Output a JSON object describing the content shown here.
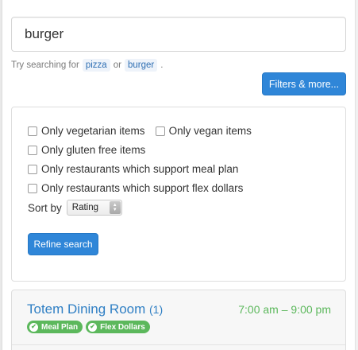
{
  "search": {
    "value": "burger"
  },
  "hint": {
    "prefix": "Try searching for",
    "example1": "pizza",
    "or": "or",
    "example2": "burger",
    "suffix": "."
  },
  "filters_button": {
    "label": "Filters & more..."
  },
  "filters": {
    "options": [
      {
        "label": "Only vegetarian items",
        "checked": false
      },
      {
        "label": "Only vegan items",
        "checked": false
      },
      {
        "label": "Only gluten free items",
        "checked": false
      },
      {
        "label": "Only restaurants which support meal plan",
        "checked": false
      },
      {
        "label": "Only restaurants which support flex dollars",
        "checked": false
      }
    ],
    "sort_label": "Sort by",
    "sort_value": "Rating",
    "refine_label": "Refine search"
  },
  "results": [
    {
      "name": "Totem Dining Room",
      "count": "(1)",
      "hours": "7:00 am – 9:00 pm",
      "badges": [
        "Meal Plan",
        "Flex Dollars"
      ]
    }
  ],
  "colors": {
    "primary": "#2f86d8",
    "link": "#2f7fc4",
    "success": "#5cb85c"
  },
  "icons": {
    "badge_icon": "check-circle-icon",
    "select_icon": "up-down-stepper-icon"
  }
}
